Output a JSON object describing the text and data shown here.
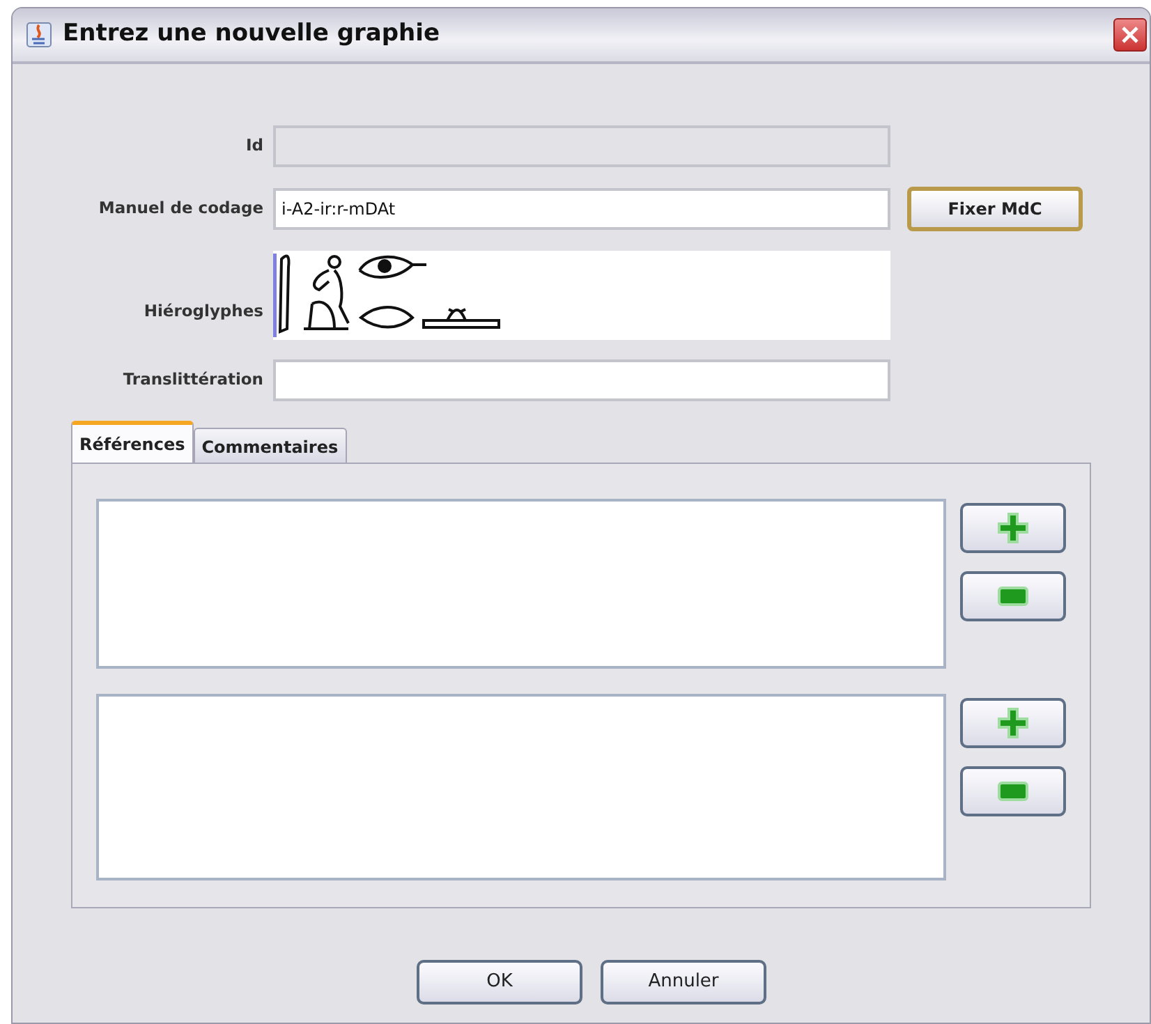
{
  "window": {
    "title": "Entrez une nouvelle graphie"
  },
  "fields": [
    {
      "kind": "text",
      "label": "Id",
      "disabled": true
    },
    {
      "kind": "text",
      "label": "Manuel de codage",
      "value": "i-A2-ir:r-mDAt",
      "disabled": false,
      "button": "Fixer MdC"
    },
    {
      "kind": "glyphs",
      "label": "Hiéroglyphes"
    },
    {
      "kind": "text",
      "label": "Translittération",
      "disabled": false
    }
  ],
  "tabs": [
    {
      "label": "Références",
      "selected": true
    },
    {
      "label": "Commentaires",
      "selected": false
    }
  ],
  "lists": [
    {
      "kind": "list"
    },
    {
      "kind": "list"
    }
  ],
  "buttons": [
    "OK",
    "Annuler"
  ]
}
